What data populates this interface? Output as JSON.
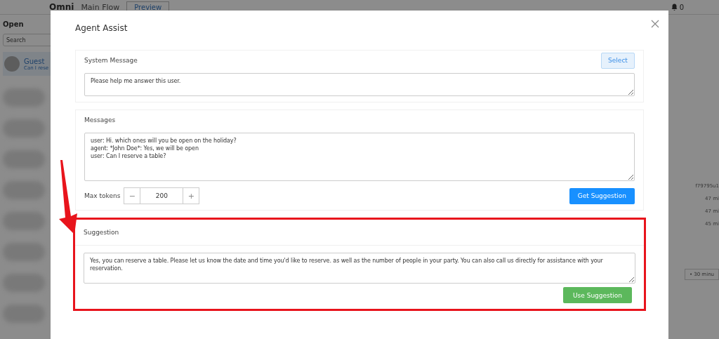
{
  "app": {
    "breadcrumb": [
      {
        "label": "Omni"
      },
      {
        "label": "Main Flow"
      }
    ],
    "preview_button": "Preview",
    "notification_count": "0",
    "filter": "Open",
    "search": {
      "placeholder": "Search"
    },
    "conversations": [
      {
        "name": "Guest",
        "preview": "Can I rese",
        "selected": true
      }
    ],
    "side_texts": [
      "f79795u1",
      "47 mi",
      "47 mi",
      "45 mi"
    ],
    "time_filter": "• 30 minu"
  },
  "modal": {
    "title": "Agent Assist",
    "system_message": {
      "label": "System Message",
      "select_button": "Select",
      "value": "Please help me answer this user."
    },
    "messages": {
      "label": "Messages",
      "value": "user: Hi. which ones will you be open on the holiday?\nagent: *John Doe*: Yes, we will be open\nuser: Can I reserve a table?",
      "max_tokens_label": "Max tokens",
      "minus": "−",
      "max_tokens": "200",
      "plus": "+",
      "get_button": "Get Suggestion"
    },
    "suggestion": {
      "label": "Suggestion",
      "highlighted": true,
      "value": "Yes, you can reserve a table. Please let us know the date and time you'd like to reserve. as well as the number of people in your party. You can also call us directly for assistance with your reservation.",
      "use_button": "Use Suggestion"
    }
  }
}
